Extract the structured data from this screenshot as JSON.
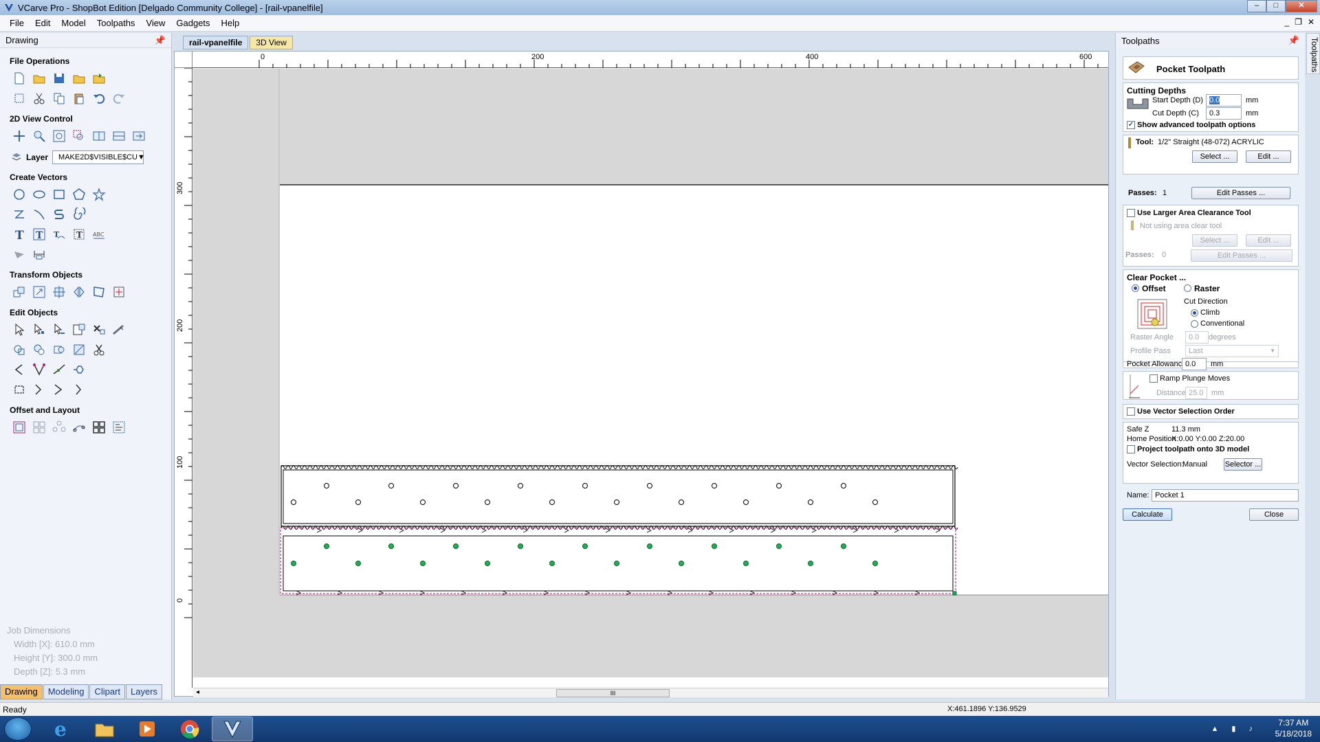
{
  "window": {
    "title": "VCarve Pro - ShopBot Edition [Delgado Community College] - [rail-vpanelfile]"
  },
  "menu": [
    "File",
    "Edit",
    "Model",
    "Toolpaths",
    "View",
    "Gadgets",
    "Help"
  ],
  "left_panel": {
    "header": "Drawing",
    "sections": {
      "file_ops": "File Operations",
      "view_ctrl": "2D View Control",
      "create_vectors": "Create Vectors",
      "transform": "Transform Objects",
      "edit_objects": "Edit Objects",
      "offset_layout": "Offset and Layout"
    },
    "layer_label": "Layer",
    "layer_value": "MAKE2D$VISIBLE$CU",
    "job_dimensions": {
      "title": "Job Dimensions",
      "width": "Width  [X]: 610.0 mm",
      "height": "Height [Y]: 300.0 mm",
      "depth": "Depth  [Z]: 5.3 mm"
    },
    "tabs": [
      "Drawing",
      "Modeling",
      "Clipart",
      "Layers"
    ]
  },
  "document": {
    "tabs": [
      "rail-vpanelfile",
      "3D View"
    ],
    "ruler_top": [
      "0",
      "200",
      "400",
      "600"
    ],
    "ruler_left": [
      "300",
      "200",
      "100",
      "0"
    ],
    "scroll_glyph": "III"
  },
  "right_panel": {
    "header": "Toolpaths",
    "vertical_tab": "Toolpaths",
    "toolpath_title": "Pocket Toolpath",
    "cutting_depths": {
      "title": "Cutting Depths",
      "start_label": "Start Depth (D)",
      "start_value": "0.0",
      "cut_label": "Cut Depth (C)",
      "cut_value": "0.3",
      "unit": "mm",
      "advanced": "Show advanced toolpath options"
    },
    "tool": {
      "label": "Tool:",
      "name": "1/2\" Straight  (48-072) ACRYLIC",
      "select": "Select ...",
      "edit": "Edit ...",
      "passes_label": "Passes:",
      "passes_value": "1",
      "edit_passes": "Edit Passes ..."
    },
    "area_clear": {
      "title": "Use Larger Area Clearance Tool",
      "status": "Not using area clear tool",
      "select": "Select ...",
      "edit": "Edit ...",
      "passes_label": "Passes:",
      "passes_value": "0",
      "edit_passes": "Edit Passes ..."
    },
    "clear_pocket": {
      "title": "Clear Pocket ...",
      "offset": "Offset",
      "raster": "Raster",
      "cut_direction": "Cut Direction",
      "climb": "Climb",
      "conventional": "Conventional",
      "raster_angle_label": "Raster Angle",
      "raster_angle_value": "0.0",
      "degrees": "degrees",
      "profile_pass_label": "Profile Pass",
      "profile_pass_value": "Last",
      "allowance_label": "Pocket Allowance",
      "allowance_value": "0.0",
      "unit": "mm"
    },
    "ramp": {
      "label": "Ramp Plunge Moves",
      "distance_label": "Distance",
      "distance_value": "25.0",
      "unit": "mm"
    },
    "vector_order": "Use Vector Selection Order",
    "safe": {
      "safe_z_label": "Safe Z",
      "safe_z_value": "11.3 mm",
      "home_label": "Home Position",
      "home_value": "X:0.00 Y:0.00 Z:20.00",
      "project": "Project toolpath onto 3D model",
      "vector_sel_label": "Vector Selection:",
      "vector_sel_value": "Manual",
      "selector": "Selector ..."
    },
    "name_label": "Name:",
    "name_value": "Pocket 1",
    "calculate": "Calculate",
    "close": "Close"
  },
  "status": {
    "text": "Ready",
    "coords": "X:461.1896 Y:136.9529"
  },
  "taskbar": {
    "time": "7:37 AM",
    "date": "5/18/2018"
  },
  "colors": {
    "accent": "#f6c06a",
    "selection": "#c0007a",
    "node": "#22b14c"
  }
}
